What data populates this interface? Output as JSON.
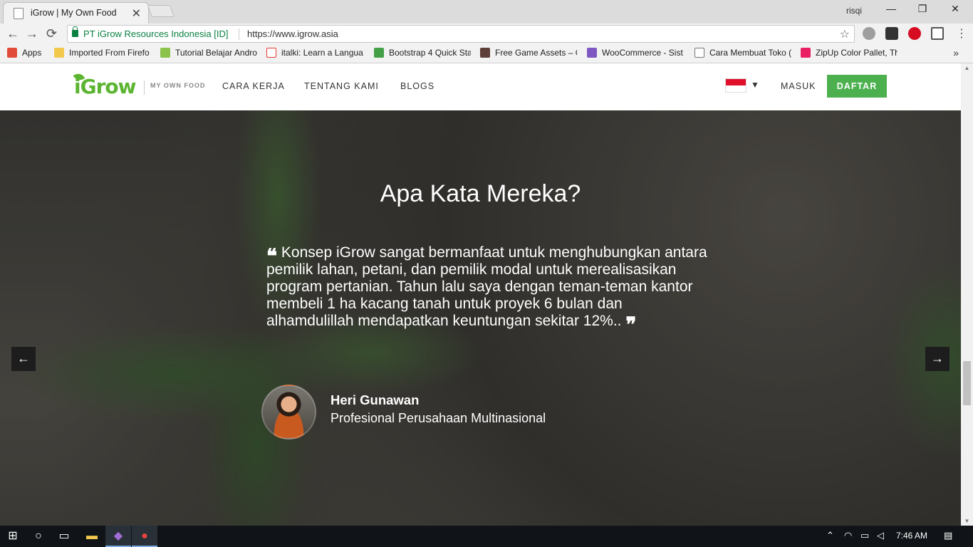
{
  "browser": {
    "tab_title": "iGrow | My Own Food",
    "tab_close": "✕",
    "profile_name": "risqi",
    "window_minimize": "—",
    "window_restore": "❐",
    "window_close": "✕",
    "secure_label": "PT iGrow Resources Indonesia [ID]",
    "url": "https://www.igrow.asia",
    "bookmarks": [
      {
        "label": "Apps",
        "icon_color": "#e04b3a"
      },
      {
        "label": "Imported From Firefo",
        "icon_color": "#f2c94c"
      },
      {
        "label": "Tutorial Belajar Andro",
        "icon_color": "#8bc34a"
      },
      {
        "label": "italki: Learn a Langua",
        "icon_color": "#e53935"
      },
      {
        "label": "Bootstrap 4 Quick Sta",
        "icon_color": "#43a047"
      },
      {
        "label": "Free Game Assets – G",
        "icon_color": "#5d4037"
      },
      {
        "label": "WooCommerce - Sist",
        "icon_color": "#7e57c2"
      },
      {
        "label": "Cara Membuat Toko (",
        "icon_color": "#ffffff"
      },
      {
        "label": "ZipUp Color Pallet, Th",
        "icon_color": "#e91e63"
      }
    ],
    "bookmarks_more": "»"
  },
  "site": {
    "logo_text": "iGrow",
    "tagline": "MY OWN FOOD",
    "nav": [
      "CARA KERJA",
      "TENTANG KAMI",
      "BLOGS"
    ],
    "language_caret": "▼",
    "login_label": "MASUK",
    "signup_label": "DAFTAR",
    "accent_color": "#4cb04f"
  },
  "testimonial": {
    "heading": "Apa Kata Mereka?",
    "open_quote": "❝",
    "close_quote": "❞",
    "quote": "Konsep iGrow sangat bermanfaat untuk menghubungkan antara pemilik lahan, petani, dan pemilik modal untuk merealisasikan program pertanian. Tahun lalu saya dengan teman-teman kantor membeli 1 ha kacang tanah untuk proyek 6 bulan dan alhamdulillah mendapatkan keuntungan sekitar 12%..",
    "author_name": "Heri Gunawan",
    "author_role": "Profesional Perusahaan Multinasional",
    "prev_arrow": "←",
    "next_arrow": "→"
  },
  "taskbar": {
    "time": "7:46 AM"
  }
}
